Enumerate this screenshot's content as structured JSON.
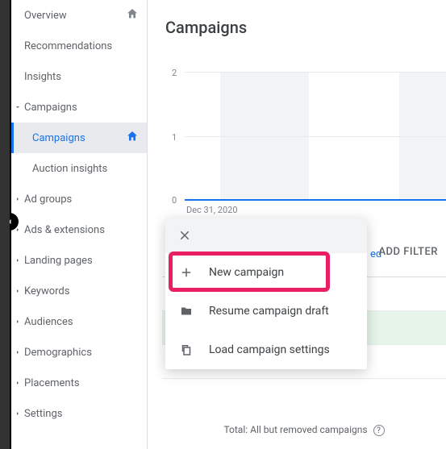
{
  "pageTitle": "Campaigns",
  "sidebar": [
    {
      "label": "Overview",
      "home": true
    },
    {
      "label": "Recommendations"
    },
    {
      "label": "Insights"
    },
    {
      "label": "Campaigns",
      "caret": "down"
    },
    {
      "label": "Campaigns",
      "active": true,
      "home": true,
      "indent": true
    },
    {
      "label": "Auction insights",
      "indent": true
    },
    {
      "label": "Ad groups",
      "caret": "right"
    },
    {
      "label": "Ads & extensions",
      "caret": "right"
    },
    {
      "label": "Landing pages",
      "caret": "right"
    },
    {
      "label": "Keywords",
      "caret": "right"
    },
    {
      "label": "Audiences",
      "caret": "right"
    },
    {
      "label": "Demographics",
      "caret": "right"
    },
    {
      "label": "Placements",
      "caret": "right"
    },
    {
      "label": "Settings",
      "caret": "right"
    }
  ],
  "chart_data": {
    "type": "line",
    "title": "",
    "xlabel": "Dec 31, 2020",
    "ylabel": "",
    "yticks": [
      0,
      1,
      2
    ],
    "ylim": [
      0,
      2
    ],
    "series": [
      {
        "name": "",
        "values": [
          0,
          0,
          0,
          0,
          0,
          0,
          0
        ]
      }
    ]
  },
  "filterRow": {
    "fragment": "ed",
    "addFilter": "ADD FILTER"
  },
  "popup": {
    "items": [
      {
        "icon": "plus",
        "label": "New campaign"
      },
      {
        "icon": "folder",
        "label": "Resume campaign draft"
      },
      {
        "icon": "copy",
        "label": "Load campaign settings"
      }
    ]
  },
  "totalRow": "Total: All but removed campaigns"
}
